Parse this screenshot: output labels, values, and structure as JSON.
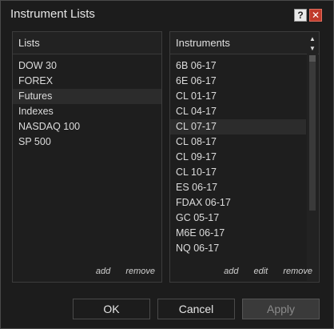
{
  "window": {
    "title": "Instrument Lists",
    "help_label": "?",
    "close_label": "✕"
  },
  "lists": {
    "header": "Lists",
    "items": [
      "DOW 30",
      "FOREX",
      "Futures",
      "Indexes",
      "NASDAQ 100",
      "SP 500"
    ],
    "selected": "Futures",
    "add_label": "add",
    "remove_label": "remove"
  },
  "instruments": {
    "header": "Instruments",
    "items": [
      "6B 06-17",
      "6E 06-17",
      "CL 01-17",
      "CL 04-17",
      "CL 07-17",
      "CL 08-17",
      "CL 09-17",
      "CL 10-17",
      "ES 06-17",
      "FDAX 06-17",
      "GC 05-17",
      "M6E 06-17",
      "NQ 06-17"
    ],
    "selected": "CL 07-17",
    "add_label": "add",
    "edit_label": "edit",
    "remove_label": "remove",
    "scroll_up": "▲",
    "scroll_down": "▼"
  },
  "buttons": {
    "ok": "OK",
    "cancel": "Cancel",
    "apply": "Apply"
  },
  "colors": {
    "background": "#1c1c1c",
    "selected_row": "#2c2c2c",
    "close_button": "#c03a2b"
  }
}
